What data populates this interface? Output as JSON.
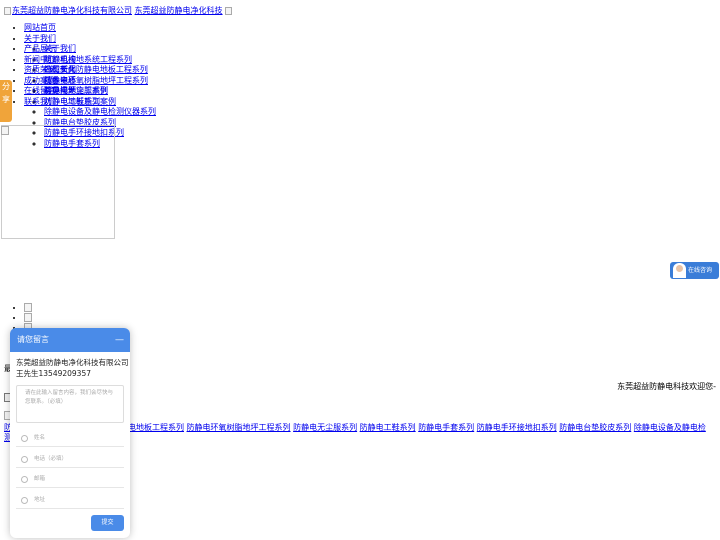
{
  "header": {
    "logo_alt": "东莞超益防静电净化科技有限公司",
    "logo_link_text": "东莞超益防静电净化科技"
  },
  "nav": [
    {
      "label": "网站首页",
      "children": []
    },
    {
      "label": "关于我们",
      "children": [
        "关于我们",
        "组织机构",
        "企业文化"
      ]
    },
    {
      "label": "产品展示",
      "children": [
        "防静电接地系统工程系列",
        "PVC长久防静电地板工程系列",
        "防静电环氧树脂地坪工程系列",
        "防静电无尘服系列",
        "防静电工鞋系列",
        "除静电设备及静电检测仪器系列",
        "防静电台垫胶皮系列",
        "防静电手环接地扣系列",
        "防静电手套系列"
      ]
    },
    {
      "label": "新闻中心",
      "children": [
        "公司新闻",
        "技术中心",
        "常见问题"
      ]
    },
    {
      "label": "资质荣誉",
      "children": [
        "企业资质"
      ]
    },
    {
      "label": "成功案例",
      "children": [
        "静电接地施工案例",
        "防静电地板施工案例"
      ]
    },
    {
      "label": "在线留言",
      "children": []
    },
    {
      "label": "联系我们",
      "children": []
    }
  ],
  "share_tab": {
    "label": "分享"
  },
  "online_chat": {
    "label": "在线咨询"
  },
  "welcome_text": "东莞超益防静电科技欢迎您-",
  "left_fragment": "最",
  "product_links": {
    "first_line_start": "防",
    "items": [
      "电地板工程系列",
      "防静电环氧树脂地坪工程系列",
      "防静电无尘服系列",
      "防静电工鞋系列",
      "防静电手套系列",
      "防静电手环接地扣系列",
      "防静电台垫胶皮系列",
      "除静电设备及静电检"
    ],
    "second_line_start": "测"
  },
  "message_panel": {
    "title": "请您留言",
    "close_symbol": "—",
    "company": "东莞超益防静电净化科技有限公司",
    "contact": "王先生13549209357",
    "textarea_placeholder": "请在此输入留言内容，我们会尽快与您联系。（必填）",
    "fields": [
      {
        "placeholder": "姓名"
      },
      {
        "placeholder": "电话（必填）"
      },
      {
        "placeholder": "邮箱"
      },
      {
        "placeholder": "地址"
      }
    ],
    "submit_label": "提交"
  }
}
